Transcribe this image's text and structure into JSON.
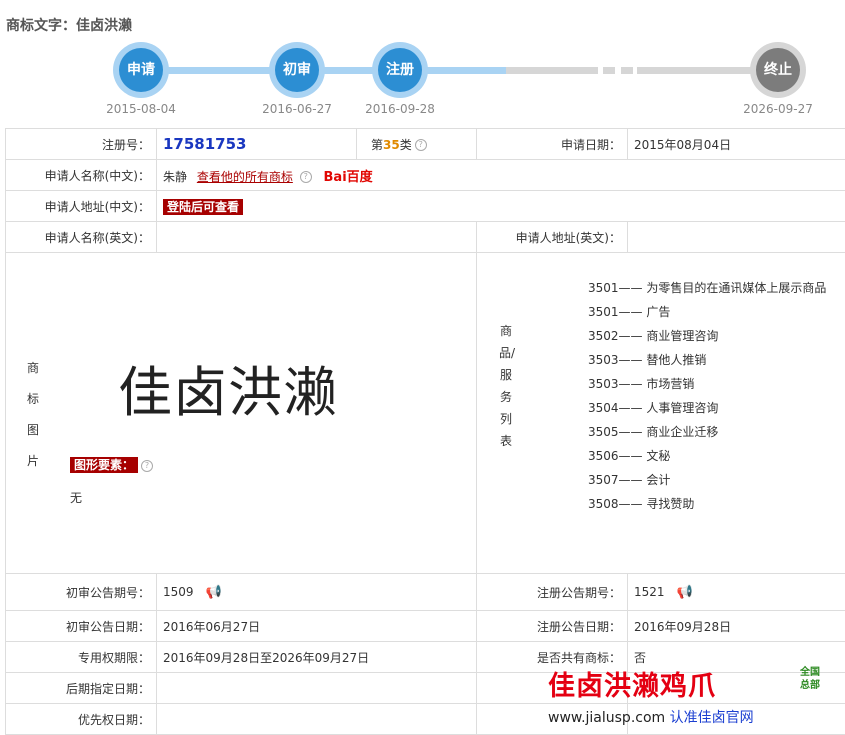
{
  "title": "商标文字：佳卤洪濑",
  "timeline": {
    "steps": [
      {
        "label": "申请",
        "date": "2015-08-04"
      },
      {
        "label": "初审",
        "date": "2016-06-27"
      },
      {
        "label": "注册",
        "date": "2016-09-28"
      },
      {
        "label": "终止",
        "date": "2026-09-27"
      }
    ]
  },
  "info": {
    "reg_no_label": "注册号：",
    "reg_no": "17581753",
    "class_prefix": "第",
    "class_num": "35",
    "class_suffix": "类",
    "apply_date_label": "申请日期：",
    "apply_date": "2015年08月04日",
    "applicant_cn_label": "申请人名称(中文)：",
    "applicant_cn": "朱静",
    "view_all_link": "查看他的所有商标",
    "baidu_logo": "Bai百度",
    "address_cn_label": "申请人地址(中文)：",
    "login_badge": "登陆后可查看",
    "applicant_en_label": "申请人名称(英文)：",
    "address_en_label": "申请人地址(英文)：",
    "mark_image_label": "商标图片",
    "mark_text": "佳卤洪濑",
    "graphic_label": "图形要素：",
    "graphic_value": "无",
    "goods_label": "商品/服务列表",
    "goods": [
      "3501—— 为零售目的在通讯媒体上展示商品",
      "3501—— 广告",
      "3502—— 商业管理咨询",
      "3503—— 替他人推销",
      "3503—— 市场营销",
      "3504—— 人事管理咨询",
      "3505—— 商业企业迁移",
      "3506—— 文秘",
      "3507—— 会计",
      "3508—— 寻找赞助"
    ],
    "prelim_issue_label": "初审公告期号：",
    "prelim_issue": "1509",
    "reg_issue_label": "注册公告期号：",
    "reg_issue": "1521",
    "prelim_date_label": "初审公告日期：",
    "prelim_date": "2016年06月27日",
    "reg_date_label": "注册公告日期：",
    "reg_date": "2016年09月28日",
    "exclusive_label": "专用权期限：",
    "exclusive": "2016年09月28日至2026年09月27日",
    "shared_label": "是否共有商标：",
    "shared": "否",
    "later_label": "后期指定日期：",
    "priority_label": "优先权日期："
  },
  "watermark": {
    "line1": "佳卤洪濑鸡爪",
    "small": "全国总部",
    "url": "www.jialusp.com",
    "slogan": "认准佳卤官网"
  }
}
